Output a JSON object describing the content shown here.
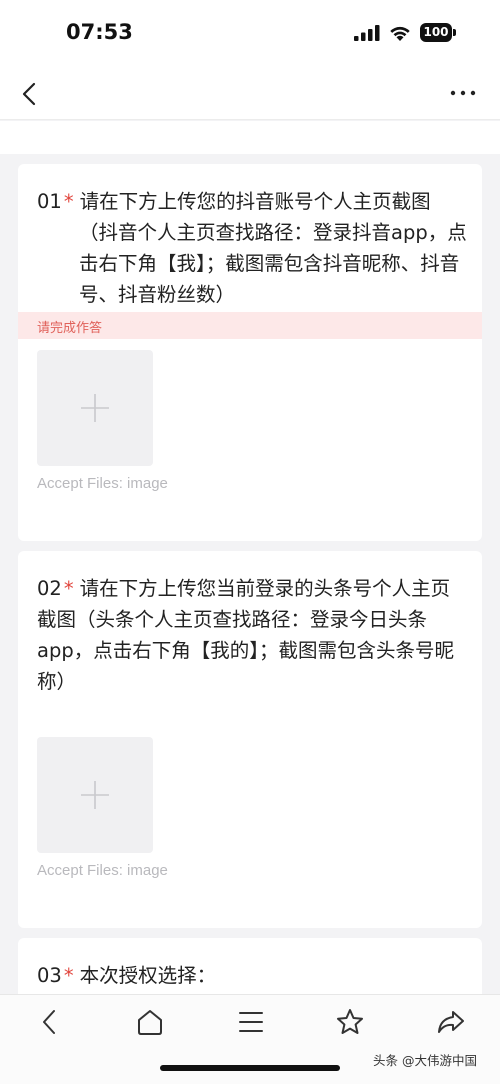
{
  "status": {
    "time": "07:53",
    "battery": "100"
  },
  "nav": {
    "back_icon": "chevron-left-icon",
    "more_icon": "more-horizontal-icon"
  },
  "questions": [
    {
      "number": "01",
      "required_mark": "*",
      "text_line1": "请在下方上传您的抖音账号个人主页截图",
      "text_rest": "（抖音个人主页查找路径：登录抖音app，点击右下角【我】；截图需包含抖音昵称、抖音号、抖音粉丝数）",
      "error": "请完成作答",
      "accept": "Accept Files: image"
    },
    {
      "number": "02",
      "required_mark": "*",
      "text": "请在下方上传您当前登录的头条号个人主页截图（头条个人主页查找路径：登录今日头条app，点击右下角【我的】；截图需包含头条号昵称）",
      "accept": "Accept Files: image"
    },
    {
      "number": "03",
      "required_mark": "*",
      "text": "本次授权选择："
    }
  ],
  "toolbar": {
    "items": [
      "back-icon",
      "home-icon",
      "menu-icon",
      "star-icon",
      "share-icon"
    ]
  },
  "watermark": "头条 @大伟游中国",
  "colors": {
    "required": "#e1463e",
    "error_bg": "#fde8e8",
    "error_text": "#e0615a",
    "page_bg": "#f3f3f5"
  }
}
